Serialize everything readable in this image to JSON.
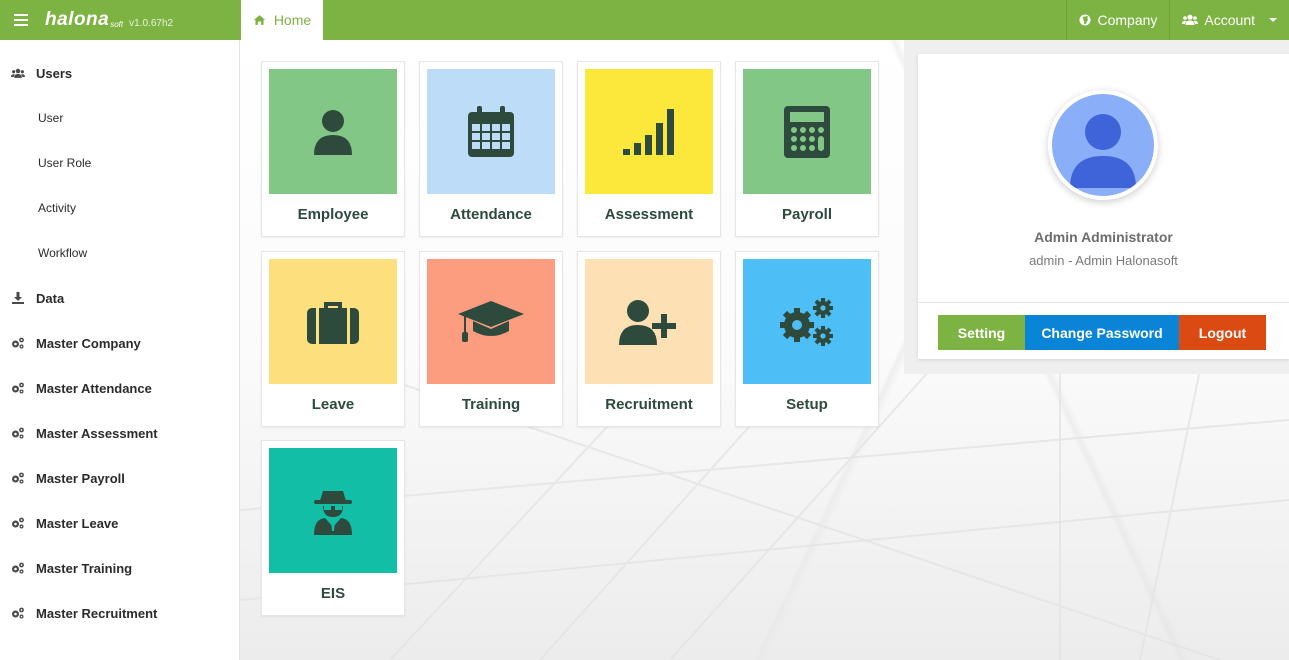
{
  "header": {
    "logo": "halona",
    "logo_sub": "soft",
    "version": "v1.0.67h2",
    "home_tab": "Home",
    "company": "Company",
    "account": "Account"
  },
  "sidebar": {
    "items": [
      {
        "label": "Users",
        "icon": "users-icon"
      },
      {
        "label": "User"
      },
      {
        "label": "User Role"
      },
      {
        "label": "Activity"
      },
      {
        "label": "Workflow"
      },
      {
        "label": "Data",
        "icon": "download-icon"
      },
      {
        "label": "Master Company",
        "icon": "cogs-icon"
      },
      {
        "label": "Master Attendance",
        "icon": "cogs-icon"
      },
      {
        "label": "Master Assessment",
        "icon": "cogs-icon"
      },
      {
        "label": "Master Payroll",
        "icon": "cogs-icon"
      },
      {
        "label": "Master Leave",
        "icon": "cogs-icon"
      },
      {
        "label": "Master Training",
        "icon": "cogs-icon"
      },
      {
        "label": "Master Recruitment",
        "icon": "cogs-icon"
      }
    ]
  },
  "tiles": [
    {
      "label": "Employee",
      "icon": "user-icon",
      "color": "#82c785"
    },
    {
      "label": "Attendance",
      "icon": "calendar-icon",
      "color": "#bcdcf7"
    },
    {
      "label": "Assessment",
      "icon": "signal-bars-icon",
      "color": "#fce83a"
    },
    {
      "label": "Payroll",
      "icon": "calculator-icon",
      "color": "#82c785"
    },
    {
      "label": "Leave",
      "icon": "briefcase-icon",
      "color": "#fde07e"
    },
    {
      "label": "Training",
      "icon": "graduation-cap-icon",
      "color": "#fd9d80"
    },
    {
      "label": "Recruitment",
      "icon": "user-plus-icon",
      "color": "#fde0b3"
    },
    {
      "label": "Setup",
      "icon": "cogs-icon",
      "color": "#4ebef7"
    },
    {
      "label": "EIS",
      "icon": "user-secret-icon",
      "color": "#12bea6"
    }
  ],
  "profile": {
    "name": "Admin Administrator",
    "role": "admin - Admin Halonasoft",
    "setting_label": "Setting",
    "change_password_label": "Change Password",
    "logout_label": "Logout"
  },
  "colors": {
    "brand": "#7db343",
    "tile_icon": "#2d4a3d",
    "setting_button": "#7db343",
    "change_password_button": "#0a84d6",
    "logout_button": "#db4a12"
  }
}
